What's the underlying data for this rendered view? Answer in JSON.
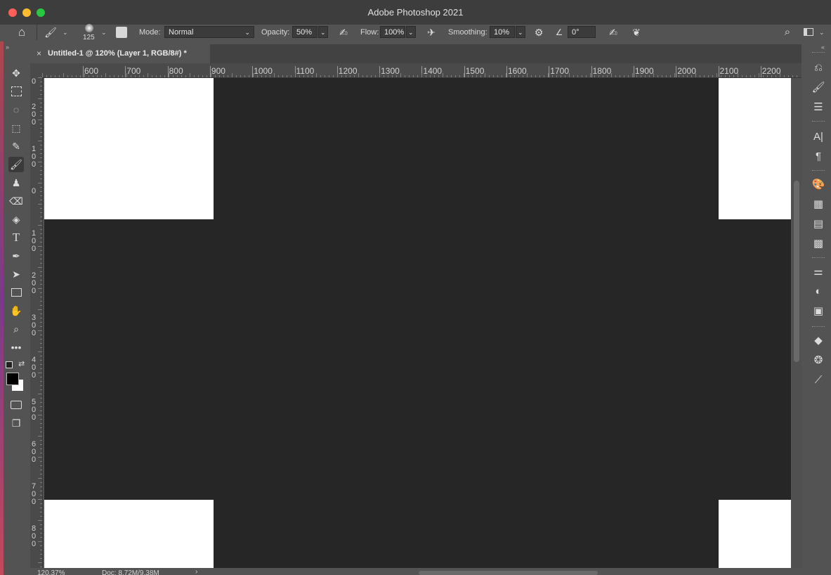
{
  "window": {
    "title": "Adobe Photoshop 2021",
    "traffic_colors": [
      "#fe5f57",
      "#febc2e",
      "#28c840"
    ]
  },
  "options_bar": {
    "brush_size": "125",
    "mode_label": "Mode:",
    "mode_value": "Normal",
    "opacity_label": "Opacity:",
    "opacity_value": "50%",
    "flow_label": "Flow:",
    "flow_value": "100%",
    "smoothing_label": "Smoothing:",
    "smoothing_value": "10%",
    "angle_value": "0°"
  },
  "document_tab": {
    "title": "Untitled-1 @ 120% (Layer 1, RGB/8#) *",
    "close_glyph": "×"
  },
  "rulers": {
    "horizontal": [
      "600",
      "700",
      "800",
      "900",
      "1000",
      "1100",
      "1200",
      "1300",
      "1400",
      "1500",
      "1600",
      "1700",
      "1800",
      "1900",
      "2000",
      "2100",
      "2200"
    ],
    "vertical": [
      "0",
      "200",
      "100",
      "0",
      "100",
      "200",
      "300",
      "400",
      "500",
      "600",
      "700",
      "800"
    ]
  },
  "status_bar": {
    "zoom": "120.37%",
    "doc": "Doc: 8.72M/9.38M",
    "arrow": "›"
  },
  "colors": {
    "canvas": "#262626",
    "paper": "#ffffff",
    "chrome": "#535353",
    "foreground_swatch": "#000000",
    "background_swatch": "#ffffff"
  },
  "icons": {
    "home": "home-icon",
    "brush": "brush-icon",
    "search": "search-icon",
    "workspace": "workspace-icon"
  }
}
